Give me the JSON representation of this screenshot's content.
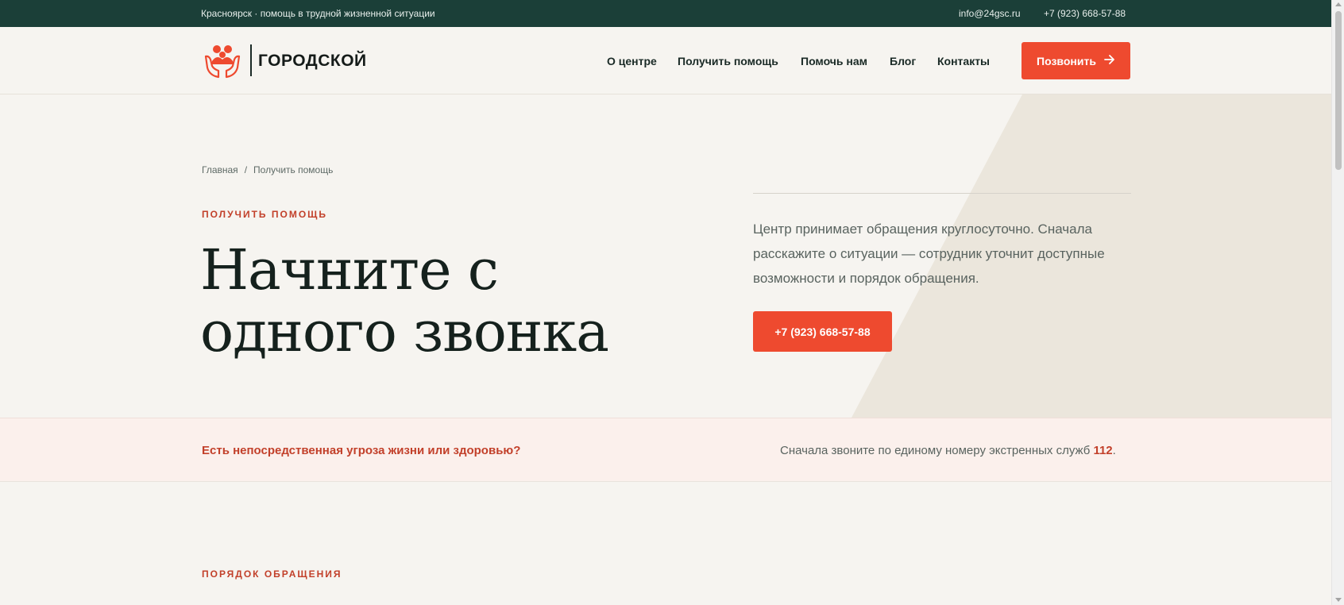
{
  "topbar": {
    "tagline": "Красноярск · помощь в трудной жизненной ситуации",
    "email": "info@24gsc.ru",
    "phone": "+7 (923) 668-57-88"
  },
  "header": {
    "logo_text": "ГОРОДСКОЙ",
    "logo_icon": "hands-family-icon",
    "nav": [
      {
        "label": "О центре"
      },
      {
        "label": "Получить помощь"
      },
      {
        "label": "Помочь нам"
      },
      {
        "label": "Блог"
      },
      {
        "label": "Контакты"
      }
    ],
    "call_button": {
      "label": "Позвонить",
      "icon": "arrow-right-icon"
    }
  },
  "hero": {
    "breadcrumb": [
      {
        "label": "Главная"
      },
      {
        "label": "Получить помощь"
      }
    ],
    "breadcrumb_separator": "/",
    "eyebrow": "Получить помощь",
    "title": "Начните с одного звонка",
    "description": "Центр принимает обращения круглосуточно. Сначала расскажите о ситуации — сотрудник уточнит доступные возможности и порядок обращения.",
    "phone_button": "+7 (923) 668-57-88"
  },
  "alert": {
    "question": "Есть непосредственная угроза жизни или здоровью?",
    "note_text": "Сначала звоните по единому номеру экстренных служб ",
    "emergency_number": "112",
    "note_end": "."
  },
  "section": {
    "eyebrow": "Порядок обращения"
  },
  "colors": {
    "topbar_bg": "#1b3f38",
    "accent": "#ee4a2f",
    "accent_text": "#c2402a",
    "page_bg": "#f6f4f0",
    "hero_shape": "#ebe6dc",
    "alert_bg": "#fbf0ec"
  }
}
